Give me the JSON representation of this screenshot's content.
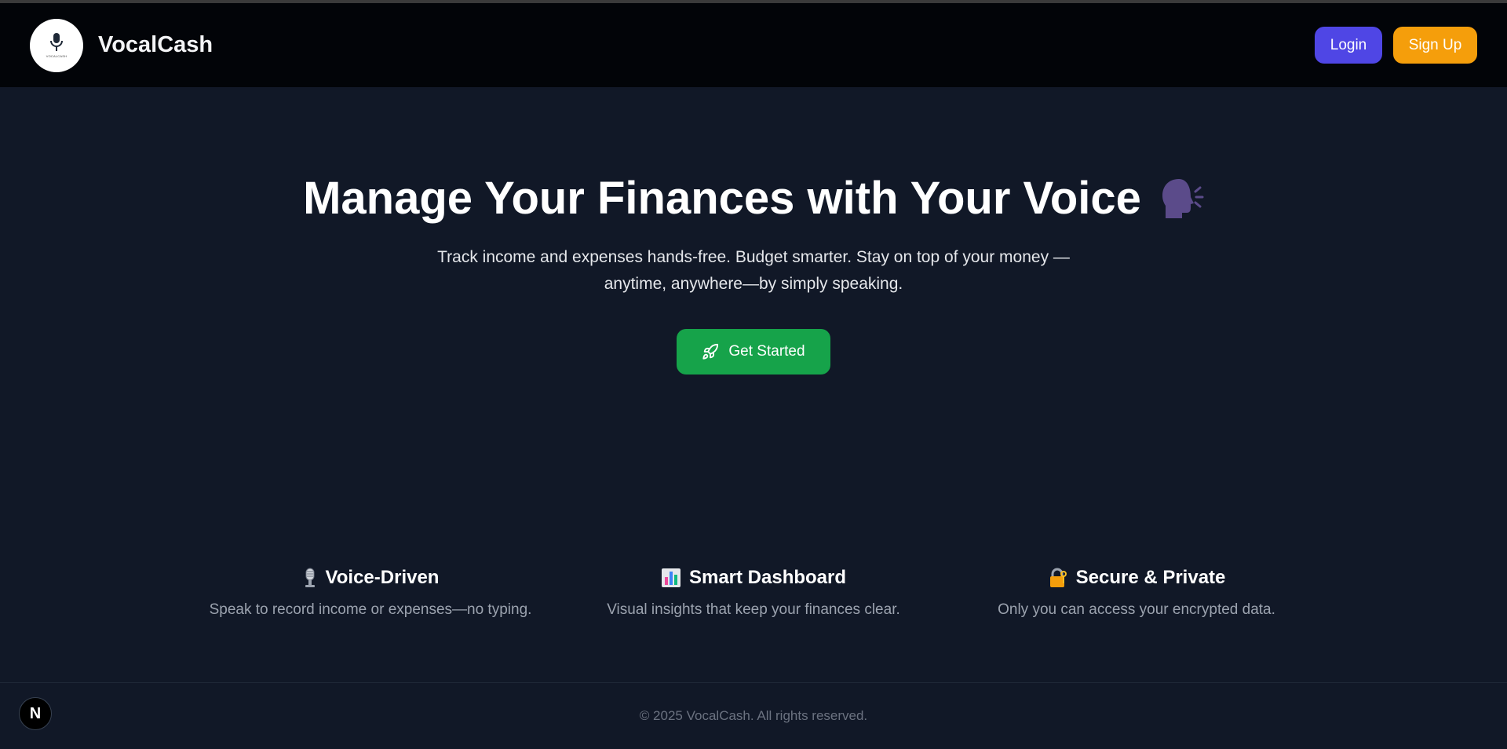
{
  "header": {
    "brand": "VocalCash",
    "logo_caption": "VOCALCASH",
    "login_label": "Login",
    "signup_label": "Sign Up"
  },
  "hero": {
    "title": "Manage Your Finances with Your Voice",
    "title_icon": "speaking-head-icon",
    "subtitle": "Track income and expenses hands-free. Budget smarter. Stay on top of your money —anytime, anywhere—by simply speaking.",
    "cta_label": "Get Started",
    "cta_icon": "rocket-icon"
  },
  "features": [
    {
      "icon": "microphone-icon",
      "title": "Voice-Driven",
      "desc": "Speak to record income or expenses—no typing."
    },
    {
      "icon": "bar-chart-icon",
      "title": "Smart Dashboard",
      "desc": "Visual insights that keep your finances clear."
    },
    {
      "icon": "locked-with-key-icon",
      "title": "Secure & Private",
      "desc": "Only you can access your encrypted data."
    }
  ],
  "footer": {
    "copyright": "© 2025 VocalCash. All rights reserved.",
    "badge": "N"
  },
  "colors": {
    "background": "#111827",
    "header": "#020408",
    "login": "#4f46e5",
    "signup": "#f59e0b",
    "cta": "#16a34a",
    "speaking_head": "#5b4b8a"
  }
}
